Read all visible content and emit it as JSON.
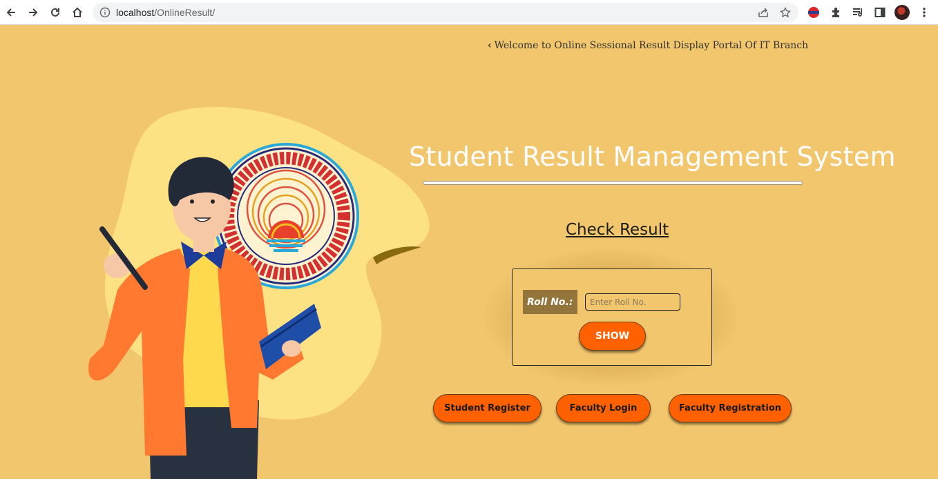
{
  "browser": {
    "url_host": "localhost",
    "url_path": "/OnlineResult/"
  },
  "page": {
    "welcome_text": "Welcome to Online Sessional Result Display Portal Of IT Branch",
    "title": "Student Result Management System",
    "check_result": "Check Result",
    "roll_label": "Roll No.:",
    "roll_placeholder": "Enter Roll No.",
    "show_label": "SHOW",
    "buttons": {
      "student_register": "Student Register",
      "faculty_login": "Faculty Login",
      "faculty_registration": "Faculty Registration"
    },
    "logo_text": "डॉ. राममनोहर लोहिया अवध विश्वविद्यालय · ज्योतिषां ज्योतिरेकम्"
  },
  "colors": {
    "background": "#f2c66c",
    "button": "#ff6100",
    "label_bg": "#93753c",
    "blob": "#fde283"
  }
}
